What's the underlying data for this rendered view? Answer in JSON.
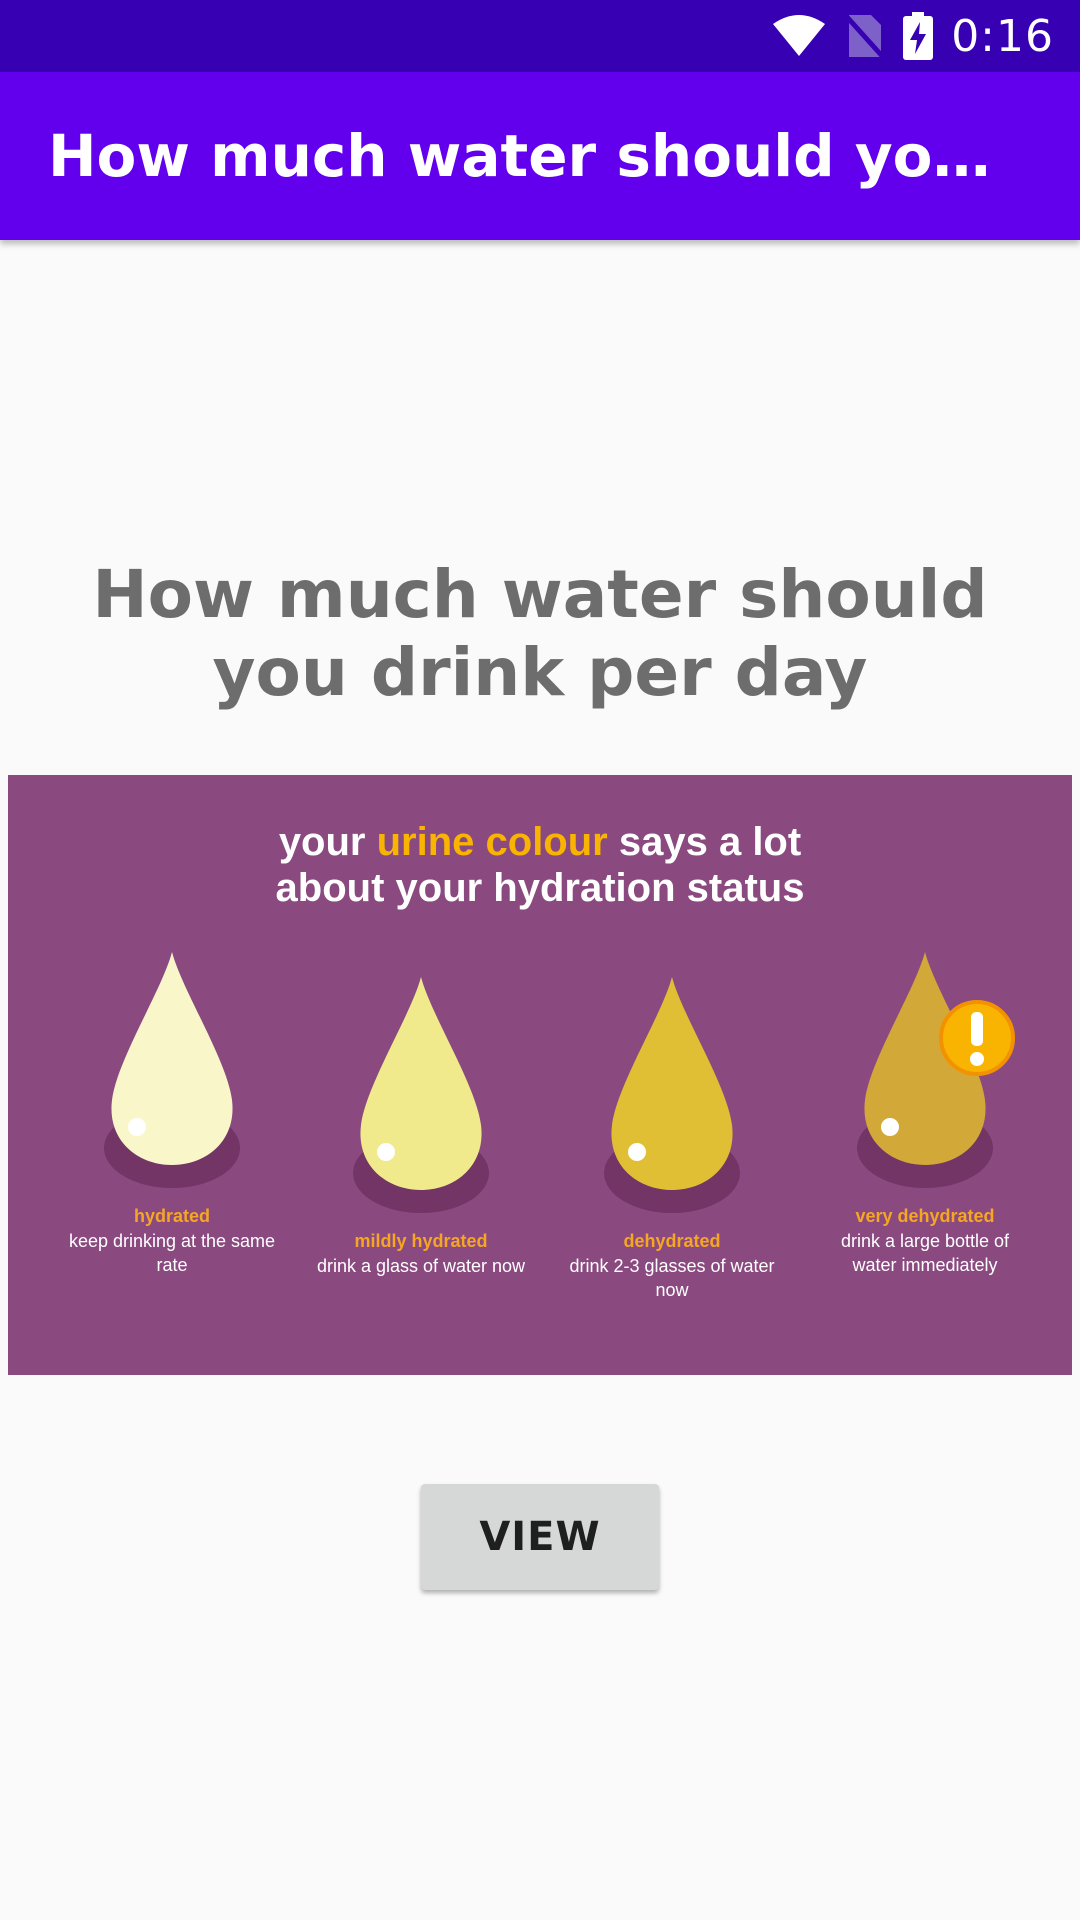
{
  "status_bar": {
    "time": "0:16",
    "icons": [
      "wifi-icon",
      "no-sim-icon",
      "battery-charging-icon"
    ]
  },
  "app_bar": {
    "title": "How much water should you drink…"
  },
  "main": {
    "heading": "How much water should you drink per day",
    "infographic": {
      "headline_part1": "your ",
      "headline_highlight": "urine colour",
      "headline_part2": " says a lot",
      "headline_line2": "about your hydration status",
      "drops": [
        {
          "label": "hydrated",
          "desc": "keep drinking at the same rate",
          "color": "#f9f7c9"
        },
        {
          "label": "mildly hydrated",
          "desc": "drink a glass of water now",
          "color": "#f0ea8c"
        },
        {
          "label": "dehydrated",
          "desc": "drink 2-3 glasses of water now",
          "color": "#e0bf35"
        },
        {
          "label": "very dehydrated",
          "desc": "drink a large bottle of water immediately",
          "color": "#d2a838"
        }
      ],
      "warning_icon": "exclamation-icon",
      "colors": {
        "background": "#8a4a80",
        "highlight": "#f8b400",
        "shadow": "#733466"
      }
    },
    "view_button": "VIEW"
  }
}
